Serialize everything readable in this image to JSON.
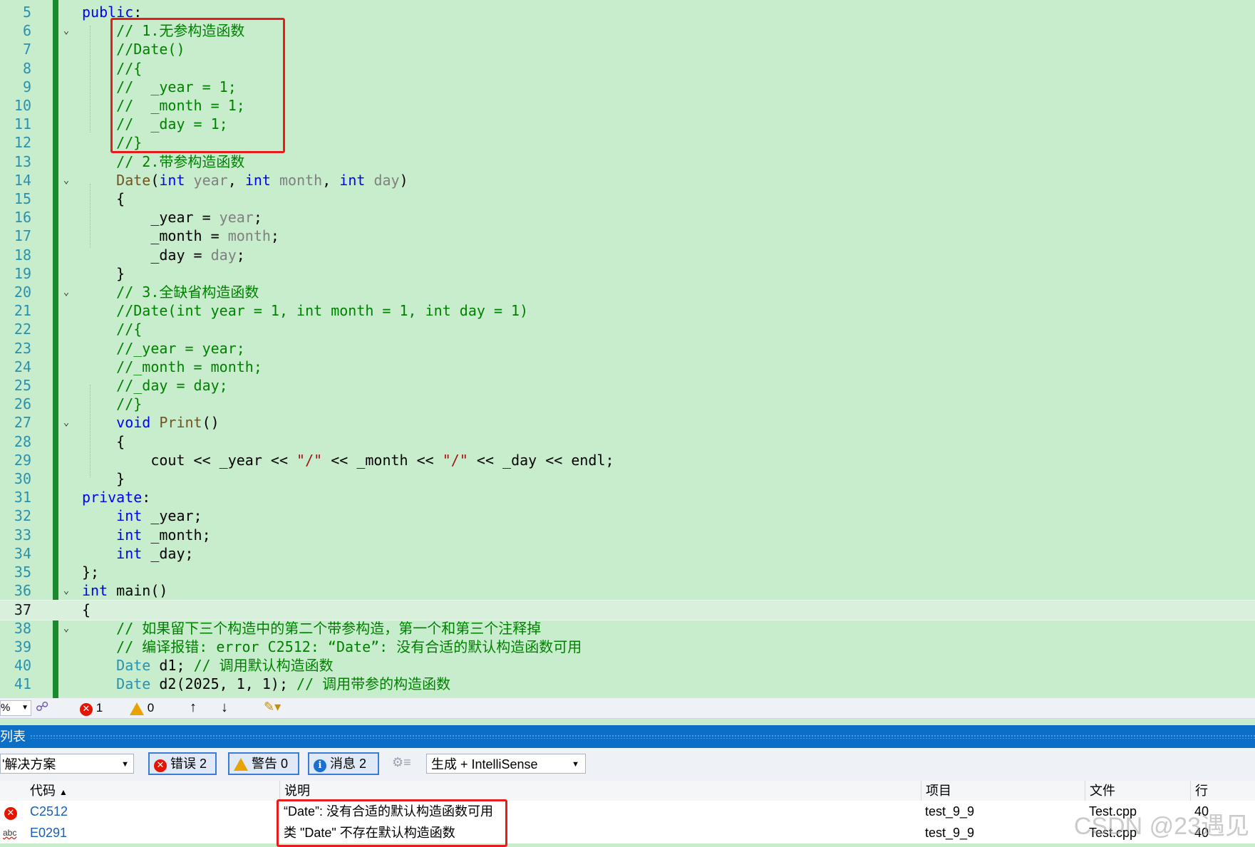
{
  "editor": {
    "lines": [
      {
        "num": "5",
        "fold": "",
        "code": [
          {
            "t": "public",
            "c": "kw"
          },
          {
            "t": ":",
            "c": ""
          }
        ]
      },
      {
        "num": "6",
        "fold": "v",
        "code": [
          {
            "t": "    // 1.无参构造函数",
            "c": "cm"
          }
        ]
      },
      {
        "num": "7",
        "fold": "",
        "code": [
          {
            "t": "    //Date()",
            "c": "cm"
          }
        ]
      },
      {
        "num": "8",
        "fold": "",
        "code": [
          {
            "t": "    //{",
            "c": "cm"
          }
        ]
      },
      {
        "num": "9",
        "fold": "",
        "code": [
          {
            "t": "    //  _year = 1;",
            "c": "cm"
          }
        ]
      },
      {
        "num": "10",
        "fold": "",
        "code": [
          {
            "t": "    //  _month = 1;",
            "c": "cm"
          }
        ]
      },
      {
        "num": "11",
        "fold": "",
        "code": [
          {
            "t": "    //  _day = 1;",
            "c": "cm"
          }
        ]
      },
      {
        "num": "12",
        "fold": "",
        "code": [
          {
            "t": "    //}",
            "c": "cm"
          }
        ]
      },
      {
        "num": "13",
        "fold": "",
        "code": [
          {
            "t": "    // 2.带参构造函数",
            "c": "cm"
          }
        ]
      },
      {
        "num": "14",
        "fold": "v",
        "code": [
          {
            "t": "    ",
            "c": ""
          },
          {
            "t": "Date",
            "c": "fn"
          },
          {
            "t": "(",
            "c": ""
          },
          {
            "t": "int",
            "c": "kw"
          },
          {
            "t": " year",
            "c": "pa"
          },
          {
            "t": ", ",
            "c": ""
          },
          {
            "t": "int",
            "c": "kw"
          },
          {
            "t": " month",
            "c": "pa"
          },
          {
            "t": ", ",
            "c": ""
          },
          {
            "t": "int",
            "c": "kw"
          },
          {
            "t": " day",
            "c": "pa"
          },
          {
            "t": ")",
            "c": ""
          }
        ]
      },
      {
        "num": "15",
        "fold": "",
        "code": [
          {
            "t": "    {",
            "c": ""
          }
        ]
      },
      {
        "num": "16",
        "fold": "",
        "code": [
          {
            "t": "        _year = ",
            "c": ""
          },
          {
            "t": "year",
            "c": "pa"
          },
          {
            "t": ";",
            "c": ""
          }
        ]
      },
      {
        "num": "17",
        "fold": "",
        "code": [
          {
            "t": "        _month = ",
            "c": ""
          },
          {
            "t": "month",
            "c": "pa"
          },
          {
            "t": ";",
            "c": ""
          }
        ]
      },
      {
        "num": "18",
        "fold": "",
        "code": [
          {
            "t": "        _day = ",
            "c": ""
          },
          {
            "t": "day",
            "c": "pa"
          },
          {
            "t": ";",
            "c": ""
          }
        ]
      },
      {
        "num": "19",
        "fold": "",
        "code": [
          {
            "t": "    }",
            "c": ""
          }
        ]
      },
      {
        "num": "20",
        "fold": "v",
        "code": [
          {
            "t": "    // 3.全缺省构造函数",
            "c": "cm"
          }
        ]
      },
      {
        "num": "21",
        "fold": "",
        "code": [
          {
            "t": "    //Date(int year = 1, int month = 1, int day = 1)",
            "c": "cm"
          }
        ]
      },
      {
        "num": "22",
        "fold": "",
        "code": [
          {
            "t": "    //{",
            "c": "cm"
          }
        ]
      },
      {
        "num": "23",
        "fold": "",
        "code": [
          {
            "t": "    //_year = year;",
            "c": "cm"
          }
        ]
      },
      {
        "num": "24",
        "fold": "",
        "code": [
          {
            "t": "    //_month = month;",
            "c": "cm"
          }
        ]
      },
      {
        "num": "25",
        "fold": "",
        "code": [
          {
            "t": "    //_day = day;",
            "c": "cm"
          }
        ]
      },
      {
        "num": "26",
        "fold": "",
        "code": [
          {
            "t": "    //}",
            "c": "cm"
          }
        ]
      },
      {
        "num": "27",
        "fold": "v",
        "code": [
          {
            "t": "    ",
            "c": ""
          },
          {
            "t": "void",
            "c": "kw"
          },
          {
            "t": " ",
            "c": ""
          },
          {
            "t": "Print",
            "c": "fn"
          },
          {
            "t": "()",
            "c": ""
          }
        ]
      },
      {
        "num": "28",
        "fold": "",
        "code": [
          {
            "t": "    {",
            "c": ""
          }
        ]
      },
      {
        "num": "29",
        "fold": "",
        "code": [
          {
            "t": "        cout << _year << ",
            "c": ""
          },
          {
            "t": "\"/\"",
            "c": "st"
          },
          {
            "t": " << _month << ",
            "c": ""
          },
          {
            "t": "\"/\"",
            "c": "st"
          },
          {
            "t": " << _day << endl;",
            "c": ""
          }
        ]
      },
      {
        "num": "30",
        "fold": "",
        "code": [
          {
            "t": "    }",
            "c": ""
          }
        ]
      },
      {
        "num": "31",
        "fold": "",
        "code": [
          {
            "t": "private",
            "c": "kw"
          },
          {
            "t": ":",
            "c": ""
          }
        ]
      },
      {
        "num": "32",
        "fold": "",
        "code": [
          {
            "t": "    ",
            "c": ""
          },
          {
            "t": "int",
            "c": "kw"
          },
          {
            "t": " _year;",
            "c": ""
          }
        ]
      },
      {
        "num": "33",
        "fold": "",
        "code": [
          {
            "t": "    ",
            "c": ""
          },
          {
            "t": "int",
            "c": "kw"
          },
          {
            "t": " _month;",
            "c": ""
          }
        ]
      },
      {
        "num": "34",
        "fold": "",
        "code": [
          {
            "t": "    ",
            "c": ""
          },
          {
            "t": "int",
            "c": "kw"
          },
          {
            "t": " _day;",
            "c": ""
          }
        ]
      },
      {
        "num": "35",
        "fold": "",
        "code": [
          {
            "t": "};",
            "c": ""
          }
        ]
      },
      {
        "num": "36",
        "fold": "v",
        "code": [
          {
            "t": "int",
            "c": "kw"
          },
          {
            "t": " main()",
            "c": ""
          }
        ]
      },
      {
        "num": "37",
        "fold": "",
        "current": true,
        "code": [
          {
            "t": "{",
            "c": ""
          }
        ]
      },
      {
        "num": "38",
        "fold": "v",
        "code": [
          {
            "t": "    // 如果留下三个构造中的第二个带参构造，第一个和第三个注释掉",
            "c": "cm"
          }
        ]
      },
      {
        "num": "39",
        "fold": "",
        "code": [
          {
            "t": "    // 编译报错: error C2512: “Date”: 没有合适的默认构造函数可用",
            "c": "cm"
          }
        ]
      },
      {
        "num": "40",
        "fold": "",
        "code": [
          {
            "t": "    ",
            "c": ""
          },
          {
            "t": "Date",
            "c": "ty"
          },
          {
            "t": " d1; ",
            "c": ""
          },
          {
            "t": "// 调用默认构造函数",
            "c": "cm"
          }
        ]
      },
      {
        "num": "41",
        "fold": "",
        "code": [
          {
            "t": "    ",
            "c": ""
          },
          {
            "t": "Date",
            "c": "ty"
          },
          {
            "t": " d2(2025, 1, 1); ",
            "c": ""
          },
          {
            "t": "// 调用带参的构造函数",
            "c": "cm"
          }
        ]
      }
    ]
  },
  "statusbar": {
    "zoom": "%",
    "error_count": "1",
    "warning_count": "0"
  },
  "error_list": {
    "title": "列表",
    "scope": "解决方案",
    "errors_label": "错误 2",
    "warnings_label": "警告 0",
    "messages_label": "消息 2",
    "build_filter": "生成 + IntelliSense",
    "columns": [
      "代码",
      "说明",
      "项目",
      "文件",
      "行"
    ],
    "rows": [
      {
        "icon": "error",
        "code": "C2512",
        "description": "“Date”: 没有合适的默认构造函数可用",
        "project": "test_9_9",
        "file": "Test.cpp",
        "line": "40"
      },
      {
        "icon": "intellisense",
        "code": "E0291",
        "description": "类 \"Date\" 不存在默认构造函数",
        "project": "test_9_9",
        "file": "Test.cpp",
        "line": "40"
      }
    ]
  },
  "watermark": "CSDN @23遇见"
}
